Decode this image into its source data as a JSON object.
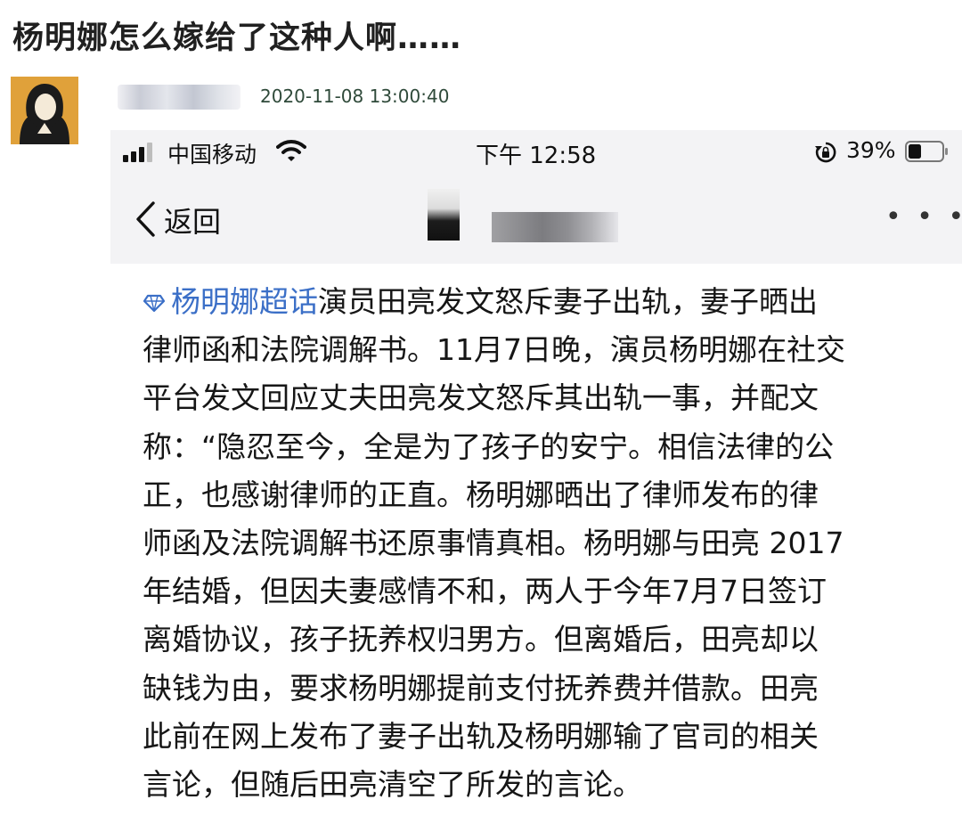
{
  "post": {
    "title": "杨明娜怎么嫁给了这种人啊……",
    "timestamp": "2020-11-08 13:00:40"
  },
  "status_bar": {
    "carrier": "中国移动",
    "time": "下午 12:58",
    "battery": "39%",
    "battery_level": 0.39
  },
  "nav": {
    "back_label": "返回",
    "more_label": "• • •"
  },
  "weibo": {
    "topic": "杨明娜超话",
    "lines": [
      "演员田亮发文怒斥妻子出轨，妻子晒出",
      "律师函和法院调解书。11月7日晚，演员杨明娜在社交",
      "平台发文回应丈夫田亮发文怒斥其出轨一事，并配文",
      "称：“隐忍至今，全是为了孩子的安宁。相信法律的公",
      "正，也感谢律师的正直。杨明娜晒出了律师发布的律",
      "师函及法院调解书还原事情真相。杨明娜与田亮 2017",
      "年结婚，但因夫妻感情不和，两人于今年7月7日签订",
      "离婚协议，孩子抚养权归男方。但离婚后，田亮却以",
      "缺钱为由，要求杨明娜提前支付抚养费并借款。田亮",
      "此前在网上发布了妻子出轨及杨明娜输了官司的相关",
      "言论，但随后田亮清空了所发的言论。"
    ]
  },
  "colors": {
    "topic_link": "#3b6fc7",
    "avatar_bg": "#e0a13a",
    "header_bg": "#f3f3f5"
  },
  "icons": [
    "signal-icon",
    "wifi-icon",
    "rotation-lock-icon",
    "battery-icon",
    "back-chevron-icon",
    "topic-diamond-icon"
  ]
}
